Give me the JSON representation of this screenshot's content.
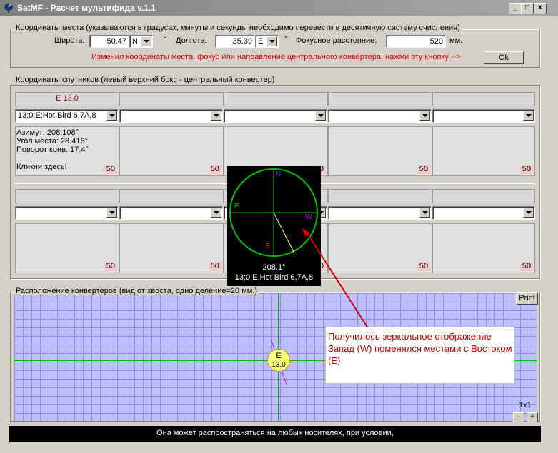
{
  "window": {
    "title": "SatMF - Расчет мультифида v.1.1",
    "min": "_",
    "max": "□",
    "close": "x"
  },
  "place": {
    "legend": "Координаты места (указываются в градусах, минуты  и секунды необходимо перевести в десятичную систему счисления)",
    "lat_label": "Широта:",
    "lat_value": "50.47",
    "lat_dir": "N",
    "deg": "°",
    "lon_label": "Долгота:",
    "lon_value": "35.39",
    "lon_dir": "E",
    "focus_label": "Фокусное расстояние:",
    "focus_value": "520",
    "focus_unit": "мм.",
    "hint": "Изменил координаты места, фокус или направление центрального конвертера, нажми эту кнопку -->",
    "ok": "Ok"
  },
  "sats": {
    "legend": "Координаты спутников (левый верхний бокс - центральный конвертер)",
    "row1": {
      "headers": [
        "E 13.0",
        "",
        "",
        "",
        ""
      ],
      "selects": [
        "13;0;E;Hot Bird 6,7A,8",
        "",
        "",
        "",
        ""
      ],
      "info": [
        "Азимут:  208.108°",
        "Угол места:  28.416°",
        "Поворот конв. 17.4°",
        "",
        "Кликни здесь!"
      ],
      "numbers": [
        "50",
        "50",
        "50",
        "50",
        "50"
      ]
    },
    "row2": {
      "headers": [
        "",
        "",
        "",
        "",
        ""
      ],
      "selects": [
        "",
        "",
        "",
        "",
        ""
      ],
      "numbers": [
        "50",
        "50",
        "50",
        "50",
        "50"
      ]
    }
  },
  "compass": {
    "n": "N",
    "e": "E",
    "s": "S",
    "w": "W",
    "value": "208.1°",
    "sat": "13;0;E;Hot Bird 6,7A,8"
  },
  "layout": {
    "legend": "Расположение конвертеров (вид от хвоста, одно деление=20 мм.)",
    "print": "Print",
    "marker_top": "E",
    "marker_bottom": "13.0",
    "zoom": "1x1",
    "zoom_minus": "-",
    "zoom_plus": "+"
  },
  "annotation": {
    "text": "Получилось зеркальное отображение Запад (W) поменялся местами с Востоком (E)"
  },
  "status": {
    "text": "Она может распространяться на любых носителях, при условии,"
  },
  "colors": {
    "annotation_text": "#cc0000",
    "compass_circle": "#00cc00",
    "grid": "#c0c0ff"
  }
}
